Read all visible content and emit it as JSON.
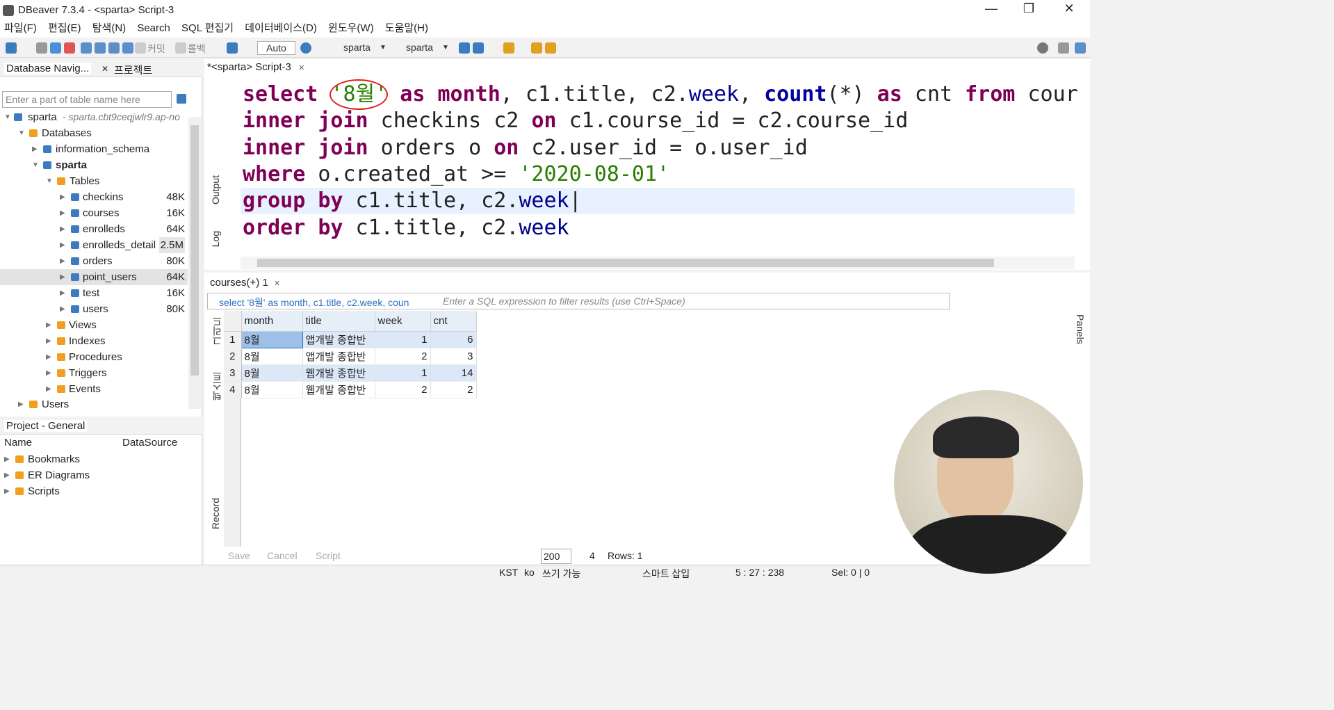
{
  "window": {
    "title": "DBeaver 7.3.4 - <sparta> Script-3"
  },
  "menu": [
    "파일(F)",
    "편집(E)",
    "탐색(N)",
    "Search",
    "SQL 편집기",
    "데이터베이스(D)",
    "윈도우(W)",
    "도움말(H)"
  ],
  "toolbar": {
    "commit": "커밋",
    "rollback": "롤백",
    "mode": "Auto",
    "datasource": "sparta",
    "schema": "sparta"
  },
  "left": {
    "tabs": [
      "Database Navig...",
      "프로젝트"
    ],
    "filter_placeholder": "Enter a part of table name here",
    "connection": {
      "name": "sparta",
      "host": "- sparta.cbt9ceqjwlr9.ap-no"
    },
    "databases_label": "Databases",
    "schemas": [
      "information_schema",
      "sparta"
    ],
    "tables_label": "Tables",
    "tables": [
      {
        "name": "checkins",
        "size": "48K"
      },
      {
        "name": "courses",
        "size": "16K"
      },
      {
        "name": "enrolleds",
        "size": "64K"
      },
      {
        "name": "enrolleds_detail",
        "size": "2.5M"
      },
      {
        "name": "orders",
        "size": "80K"
      },
      {
        "name": "point_users",
        "size": "64K"
      },
      {
        "name": "test",
        "size": "16K"
      },
      {
        "name": "users",
        "size": "80K"
      }
    ],
    "folders": [
      "Views",
      "Indexes",
      "Procedures",
      "Triggers",
      "Events"
    ],
    "users_label": "Users"
  },
  "project": {
    "tab": "Project - General",
    "columns": [
      "Name",
      "DataSource"
    ],
    "items": [
      "Bookmarks",
      "ER Diagrams",
      "Scripts"
    ]
  },
  "editor": {
    "tab": "*<sparta> Script-3",
    "side_tabs": [
      "Output",
      "Log"
    ]
  },
  "results": {
    "tab": "courses(+) 1",
    "query_preview": "select '8월' as month, c1.title, c2.week, coun",
    "filter_placeholder": "Enter a SQL expression to filter results (use Ctrl+Space)",
    "columns": [
      "month",
      "title",
      "week",
      "cnt"
    ],
    "rows": [
      [
        "1",
        "8월",
        "앱개발 종합반",
        "1",
        "6"
      ],
      [
        "2",
        "8월",
        "앱개발 종합반",
        "2",
        "3"
      ],
      [
        "3",
        "8월",
        "웹개발 종합반",
        "1",
        "14"
      ],
      [
        "4",
        "8월",
        "웹개발 종합반",
        "2",
        "2"
      ]
    ],
    "side_tabs": [
      "그리드",
      "텍스트",
      "Record"
    ],
    "right_tab": "Panels",
    "bottom": {
      "save": "Save",
      "cancel": "Cancel",
      "script": "Script",
      "fetch_size": "200",
      "count": "4",
      "rows": "Rows: 1"
    }
  },
  "status": {
    "tz": "KST",
    "lang": "ko",
    "mode": "쓰기 가능",
    "insert": "스마트 삽입",
    "pos": "5 : 27 : 238",
    "sel": "Sel: 0 | 0"
  },
  "colors": {
    "keyword": "#7f0055",
    "string": "#2a7f00",
    "accent": "#2b6fc2"
  }
}
